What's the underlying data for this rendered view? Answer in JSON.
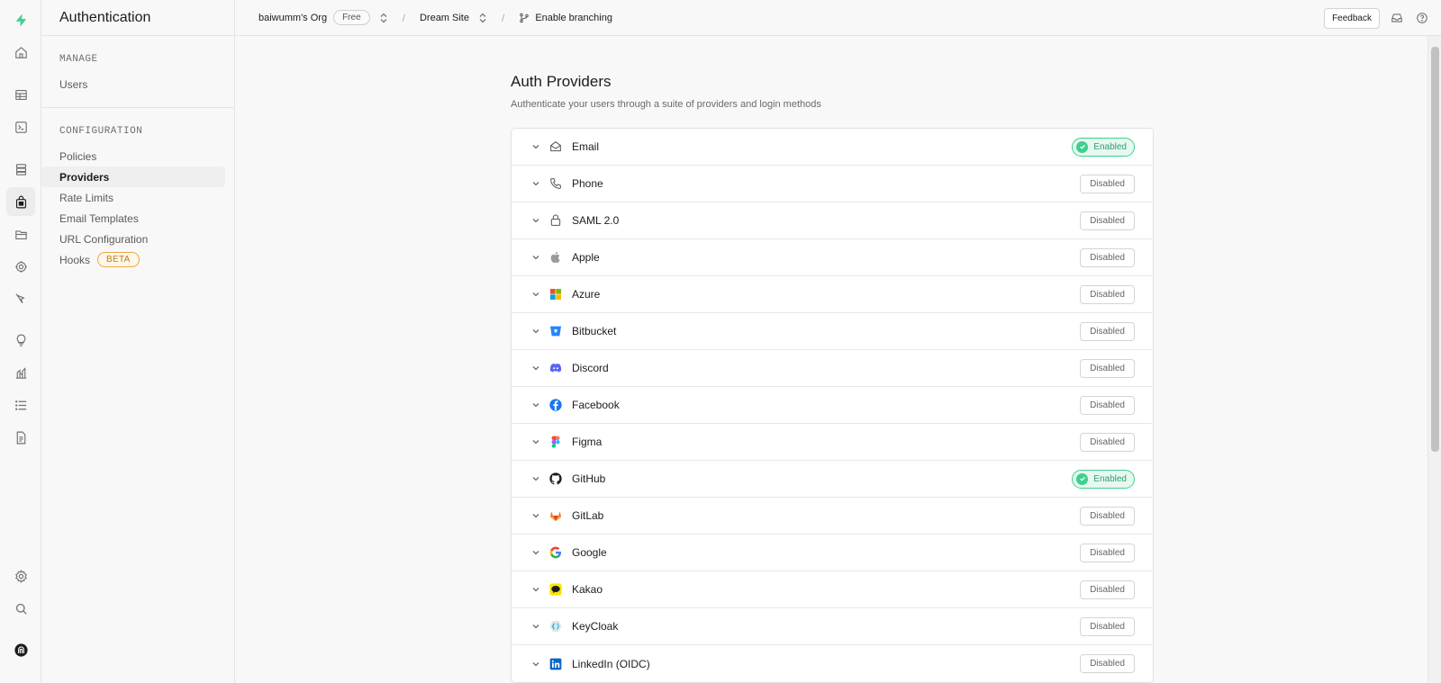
{
  "rail": {
    "items": [
      "bolt-logo",
      "home",
      "table-editor",
      "sql-editor",
      "database",
      "authentication",
      "storage",
      "edge-functions",
      "realtime",
      "advisors",
      "reports",
      "logs",
      "api-docs",
      "settings",
      "search",
      "account"
    ]
  },
  "sidebar": {
    "title": "Authentication",
    "sections": [
      {
        "heading": "MANAGE",
        "items": [
          {
            "label": "Users"
          }
        ]
      },
      {
        "heading": "CONFIGURATION",
        "items": [
          {
            "label": "Policies"
          },
          {
            "label": "Providers"
          },
          {
            "label": "Rate Limits"
          },
          {
            "label": "Email Templates"
          },
          {
            "label": "URL Configuration"
          },
          {
            "label": "Hooks",
            "badge": "BETA"
          }
        ]
      }
    ]
  },
  "topbar": {
    "org": "baiwumm's Org",
    "plan": "Free",
    "project": "Dream Site",
    "branching": "Enable branching",
    "feedback": "Feedback"
  },
  "page": {
    "title": "Auth Providers",
    "subtitle": "Authenticate your users through a suite of providers and login methods"
  },
  "providers": [
    {
      "name": "Email",
      "icon": "envelope-icon",
      "status": "Enabled"
    },
    {
      "name": "Phone",
      "icon": "phone-icon",
      "status": "Disabled"
    },
    {
      "name": "SAML 2.0",
      "icon": "lock-icon",
      "status": "Disabled"
    },
    {
      "name": "Apple",
      "icon": "apple-icon",
      "status": "Disabled"
    },
    {
      "name": "Azure",
      "icon": "azure-icon",
      "status": "Disabled"
    },
    {
      "name": "Bitbucket",
      "icon": "bitbucket-icon",
      "status": "Disabled"
    },
    {
      "name": "Discord",
      "icon": "discord-icon",
      "status": "Disabled"
    },
    {
      "name": "Facebook",
      "icon": "facebook-icon",
      "status": "Disabled"
    },
    {
      "name": "Figma",
      "icon": "figma-icon",
      "status": "Disabled"
    },
    {
      "name": "GitHub",
      "icon": "github-icon",
      "status": "Enabled"
    },
    {
      "name": "GitLab",
      "icon": "gitlab-icon",
      "status": "Disabled"
    },
    {
      "name": "Google",
      "icon": "google-icon",
      "status": "Disabled"
    },
    {
      "name": "Kakao",
      "icon": "kakao-icon",
      "status": "Disabled"
    },
    {
      "name": "KeyCloak",
      "icon": "keycloak-icon",
      "status": "Disabled"
    },
    {
      "name": "LinkedIn (OIDC)",
      "icon": "linkedin-icon",
      "status": "Disabled"
    }
  ],
  "colors": {
    "brand": "#3ecf8e",
    "beta": "#f0a940"
  }
}
